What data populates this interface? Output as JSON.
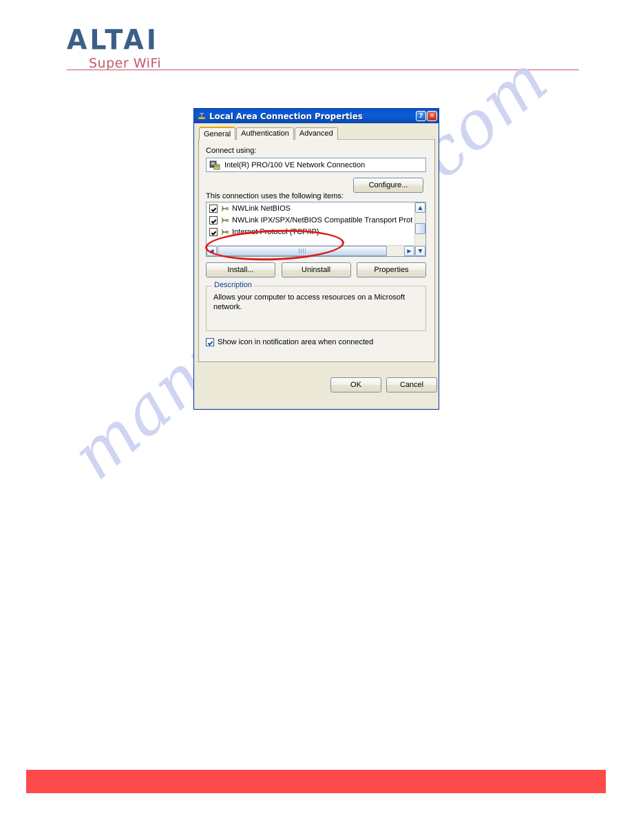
{
  "page": {
    "logo_primary": "ALTAI",
    "logo_tagline": "Super WiFi",
    "watermark": "manualshive.com"
  },
  "dialog": {
    "title": "Local Area Connection Properties",
    "title_icon": "network-connection-icon",
    "help_button": "?",
    "close_button": "✕",
    "tabs": [
      {
        "label": "General",
        "active": true
      },
      {
        "label": "Authentication",
        "active": false
      },
      {
        "label": "Advanced",
        "active": false
      }
    ],
    "general": {
      "connect_using_label": "Connect using:",
      "adapter_icon": "network-adapter-icon",
      "adapter_name": "Intel(R) PRO/100 VE Network Connection",
      "configure_label": "Configure...",
      "items_label": "This connection uses the following items:",
      "items": [
        {
          "label": "NWLink NetBIOS",
          "checked": true
        },
        {
          "label": "NWLink IPX/SPX/NetBIOS Compatible Transport Prot",
          "checked": true
        },
        {
          "label": "Internet Protocol (TCP/IP)",
          "checked": true
        }
      ],
      "buttons": {
        "install": "Install...",
        "uninstall": "Uninstall",
        "properties": "Properties"
      },
      "description_legend": "Description",
      "description_text": "Allows your computer to access resources on a Microsoft network.",
      "notify_checkbox_label": "Show icon in notification area when connected",
      "notify_checked": true
    },
    "footer": {
      "ok": "OK",
      "cancel": "Cancel"
    },
    "annotation": {
      "shape": "ellipse",
      "color": "#e01b1b",
      "targets": "Internet Protocol (TCP/IP)"
    }
  },
  "scrollbars": {
    "up_arrow": "▲",
    "down_arrow": "▼",
    "left_arrow": "◀",
    "right_arrow": "▶"
  },
  "colors": {
    "accent_red": "#fd4b4b",
    "logo_blue": "#3c5f8a",
    "logo_red": "#c0596a",
    "titlebar_blue": "#0b53c6",
    "dialog_face": "#ece9d8",
    "annotation_red": "#e01b1b"
  }
}
